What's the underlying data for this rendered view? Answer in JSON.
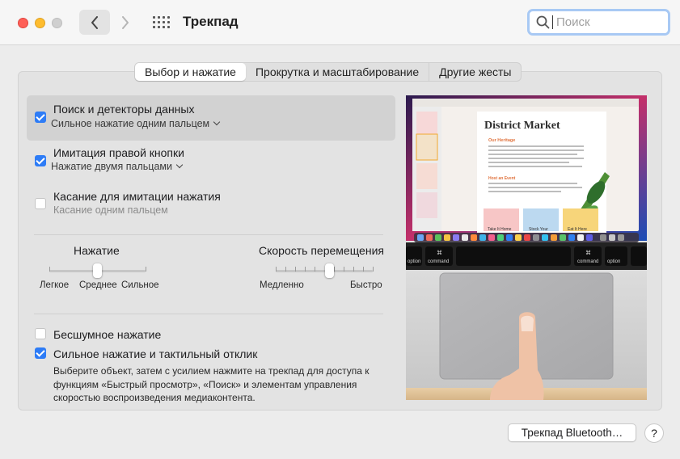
{
  "window": {
    "title": "Трекпад"
  },
  "search": {
    "placeholder": "Поиск",
    "value": ""
  },
  "tabs": [
    {
      "label": "Выбор и нажатие",
      "active": true
    },
    {
      "label": "Прокрутка и масштабирование",
      "active": false
    },
    {
      "label": "Другие жесты",
      "active": false
    }
  ],
  "options": {
    "lookup": {
      "label": "Поиск и детекторы данных",
      "sub": "Сильное нажатие одним пальцем",
      "checked": true
    },
    "secondary": {
      "label": "Имитация правой кнопки",
      "sub": "Нажатие двумя пальцами",
      "checked": true
    },
    "tap": {
      "label": "Касание для имитации нажатия",
      "sub": "Касание одним пальцем",
      "checked": false
    }
  },
  "click_slider": {
    "title": "Нажатие",
    "min_label": "Легкое",
    "mid_label": "Среднее",
    "max_label": "Сильное",
    "level": 0.5
  },
  "speed_slider": {
    "title": "Скорость перемещения",
    "min_label": "Медленно",
    "max_label": "Быстро",
    "level": 0.55
  },
  "silent": {
    "label": "Бесшумное нажатие",
    "checked": false
  },
  "force": {
    "label": "Сильное нажатие и тактильный отклик",
    "checked": true,
    "description": "Выберите объект, затем с усилием нажмите на трекпад для доступа к функциям «Быстрый просмотр», «Поиск» и элементам управления скоростью воспроизведения медиаконтента."
  },
  "preview": {
    "doc_title": "District Market",
    "section1": "Our Heritage",
    "section2": "Host an Event",
    "tiles": [
      "Take It Home",
      "Stock Your",
      "Eat It Here"
    ],
    "key_option": "option",
    "key_command": "command",
    "key_symbol": "⌘"
  },
  "footer": {
    "bluetooth_button": "Трекпад Bluetooth…",
    "help_button": "?"
  },
  "colors": {
    "accent": "#2e7cf6",
    "red": "#fe5f57",
    "yellow": "#febc2e"
  }
}
